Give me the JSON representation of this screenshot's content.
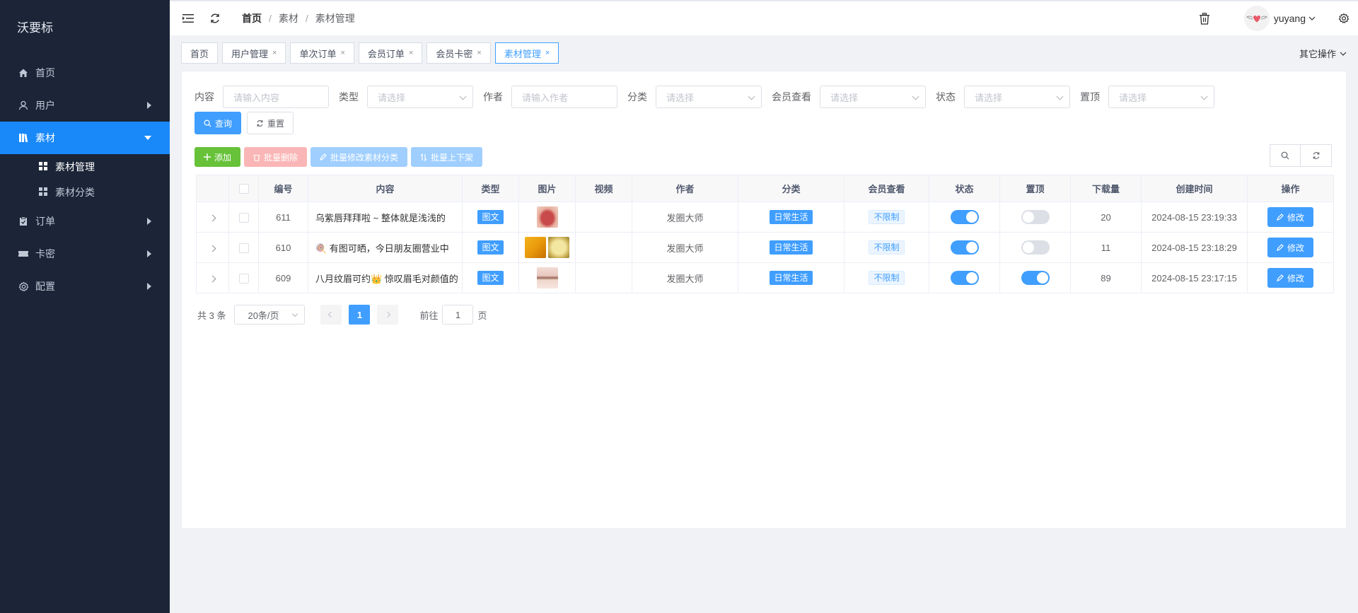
{
  "brand": "沃要标",
  "sidebar": {
    "items": [
      {
        "label": "首页"
      },
      {
        "label": "用户"
      },
      {
        "label": "素材"
      },
      {
        "label": "订单"
      },
      {
        "label": "卡密"
      },
      {
        "label": "配置"
      }
    ],
    "sub_items": [
      {
        "label": "素材管理"
      },
      {
        "label": "素材分类"
      }
    ]
  },
  "breadcrumb": [
    "首页",
    "素材",
    "素材管理"
  ],
  "breadcrumb_sep": "/",
  "user": {
    "name": "yuyang"
  },
  "tags": [
    "首页",
    "用户管理",
    "单次订单",
    "会员订单",
    "会员卡密",
    "素材管理"
  ],
  "tag_close": "×",
  "other_ops": "其它操作",
  "filters": {
    "content": {
      "label": "内容",
      "placeholder": "请输入内容"
    },
    "type": {
      "label": "类型",
      "placeholder": "请选择"
    },
    "author": {
      "label": "作者",
      "placeholder": "请输入作者"
    },
    "category": {
      "label": "分类",
      "placeholder": "请选择"
    },
    "vip": {
      "label": "会员查看",
      "placeholder": "请选择"
    },
    "status": {
      "label": "状态",
      "placeholder": "请选择"
    },
    "top": {
      "label": "置顶",
      "placeholder": "请选择"
    }
  },
  "buttons": {
    "query": "查询",
    "reset": "重置",
    "add": "添加",
    "batch_delete": "批量删除",
    "batch_edit_category": "批量修改素材分类",
    "batch_shelf": "批量上下架",
    "edit": "修改"
  },
  "table": {
    "headers": [
      "编号",
      "内容",
      "类型",
      "图片",
      "视频",
      "作者",
      "分类",
      "会员查看",
      "状态",
      "置顶",
      "下载量",
      "创建时间",
      "操作"
    ],
    "rows": [
      {
        "id": "611",
        "content": "乌紫唇拜拜啦 ~ 整体就是浅浅的",
        "type": "图文",
        "author": "发圈大师",
        "category": "日常生活",
        "vip": "不限制",
        "status": true,
        "top": false,
        "downloads": "20",
        "created": "2024-08-15 23:19:33"
      },
      {
        "id": "610",
        "content": "🍭 有图可晒，今日朋友圈营业中",
        "type": "图文",
        "author": "发圈大师",
        "category": "日常生活",
        "vip": "不限制",
        "status": true,
        "top": false,
        "downloads": "11",
        "created": "2024-08-15 23:18:29"
      },
      {
        "id": "609",
        "content": "八月纹眉可约👑 惊叹眉毛对颜值的",
        "type": "图文",
        "author": "发圈大师",
        "category": "日常生活",
        "vip": "不限制",
        "status": true,
        "top": true,
        "downloads": "89",
        "created": "2024-08-15 23:17:15"
      }
    ]
  },
  "pagination": {
    "total_text": "共 3 条",
    "page_size": "20条/页",
    "current": "1",
    "goto_label": "前往",
    "goto_value": "1",
    "page_suffix": "页"
  },
  "colors": {
    "primary": "#409eff",
    "sidebar": "#1b2537",
    "success": "#67c23a"
  }
}
